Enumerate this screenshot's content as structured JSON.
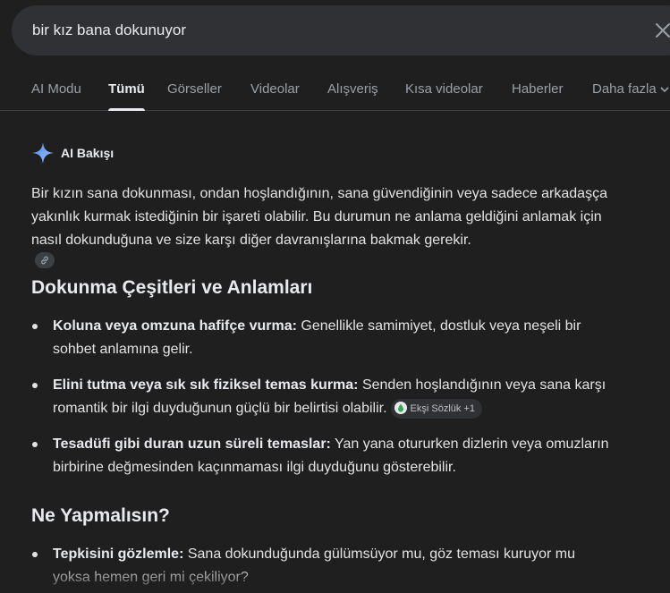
{
  "search": {
    "query": "bir kız bana dokunuyor"
  },
  "tabs": [
    {
      "label": "AI Modu",
      "active": false
    },
    {
      "label": "Tümü",
      "active": true
    },
    {
      "label": "Görseller",
      "active": false
    },
    {
      "label": "Videolar",
      "active": false
    },
    {
      "label": "Alışveriş",
      "active": false
    },
    {
      "label": "Kısa videolar",
      "active": false
    },
    {
      "label": "Haberler",
      "active": false
    },
    {
      "label": "Daha fazla",
      "active": false
    }
  ],
  "ai_overview": {
    "title": "AI Bakışı",
    "intro_lines": [
      "Bir kızın sana dokunması, ondan hoşlandığının, sana güvendiğinin veya sadece arkadaşça",
      "yakınlık kurmak istediğinin bir işareti olabilir. Bu durumun ne anlama geldiğini anlamak için",
      "nasıl dokunduğuna ve size karşı diğer davranışlarına bakmak gerekir."
    ],
    "section1_heading": "Dokunma Çeşitleri ve Anlamları",
    "section1_items": [
      {
        "bold": "Koluna veya omzuna hafifçe vurma:",
        "text1": " Genellikle samimiyet, dostluk veya neşeli bir",
        "text2": "sohbet anlamına gelir."
      },
      {
        "bold": "Elini tutma veya sık sık fiziksel temas kurma:",
        "text1": " Senden hoşlandığının veya sana karşı",
        "text2": "romantik bir ilgi duyduğunun güçlü bir belirtisi olabilir.",
        "source": "Ekşi Sözlük +1"
      },
      {
        "bold": "Tesadüfi gibi duran uzun süreli temaslar:",
        "text1": " Yan yana otururken dizlerin veya omuzların",
        "text2": "birbirine değmesinden kaçınmaması ilgi duyduğunu gösterebilir."
      }
    ],
    "section2_heading": "Ne Yapmalısın?",
    "section2_items": [
      {
        "bold": "Tepkisini gözlemle:",
        "text1": " Sana dokunduğunda gülümsüyor mu, göz teması kuruyor mu",
        "text2": "yoksa hemen geri mi çekiliyor?"
      }
    ]
  },
  "colors": {
    "background": "#1f1f1f",
    "search_bg": "#303134",
    "text": "#e3e3e3",
    "muted": "#9aa0a6",
    "source_drop": "#34a853"
  }
}
